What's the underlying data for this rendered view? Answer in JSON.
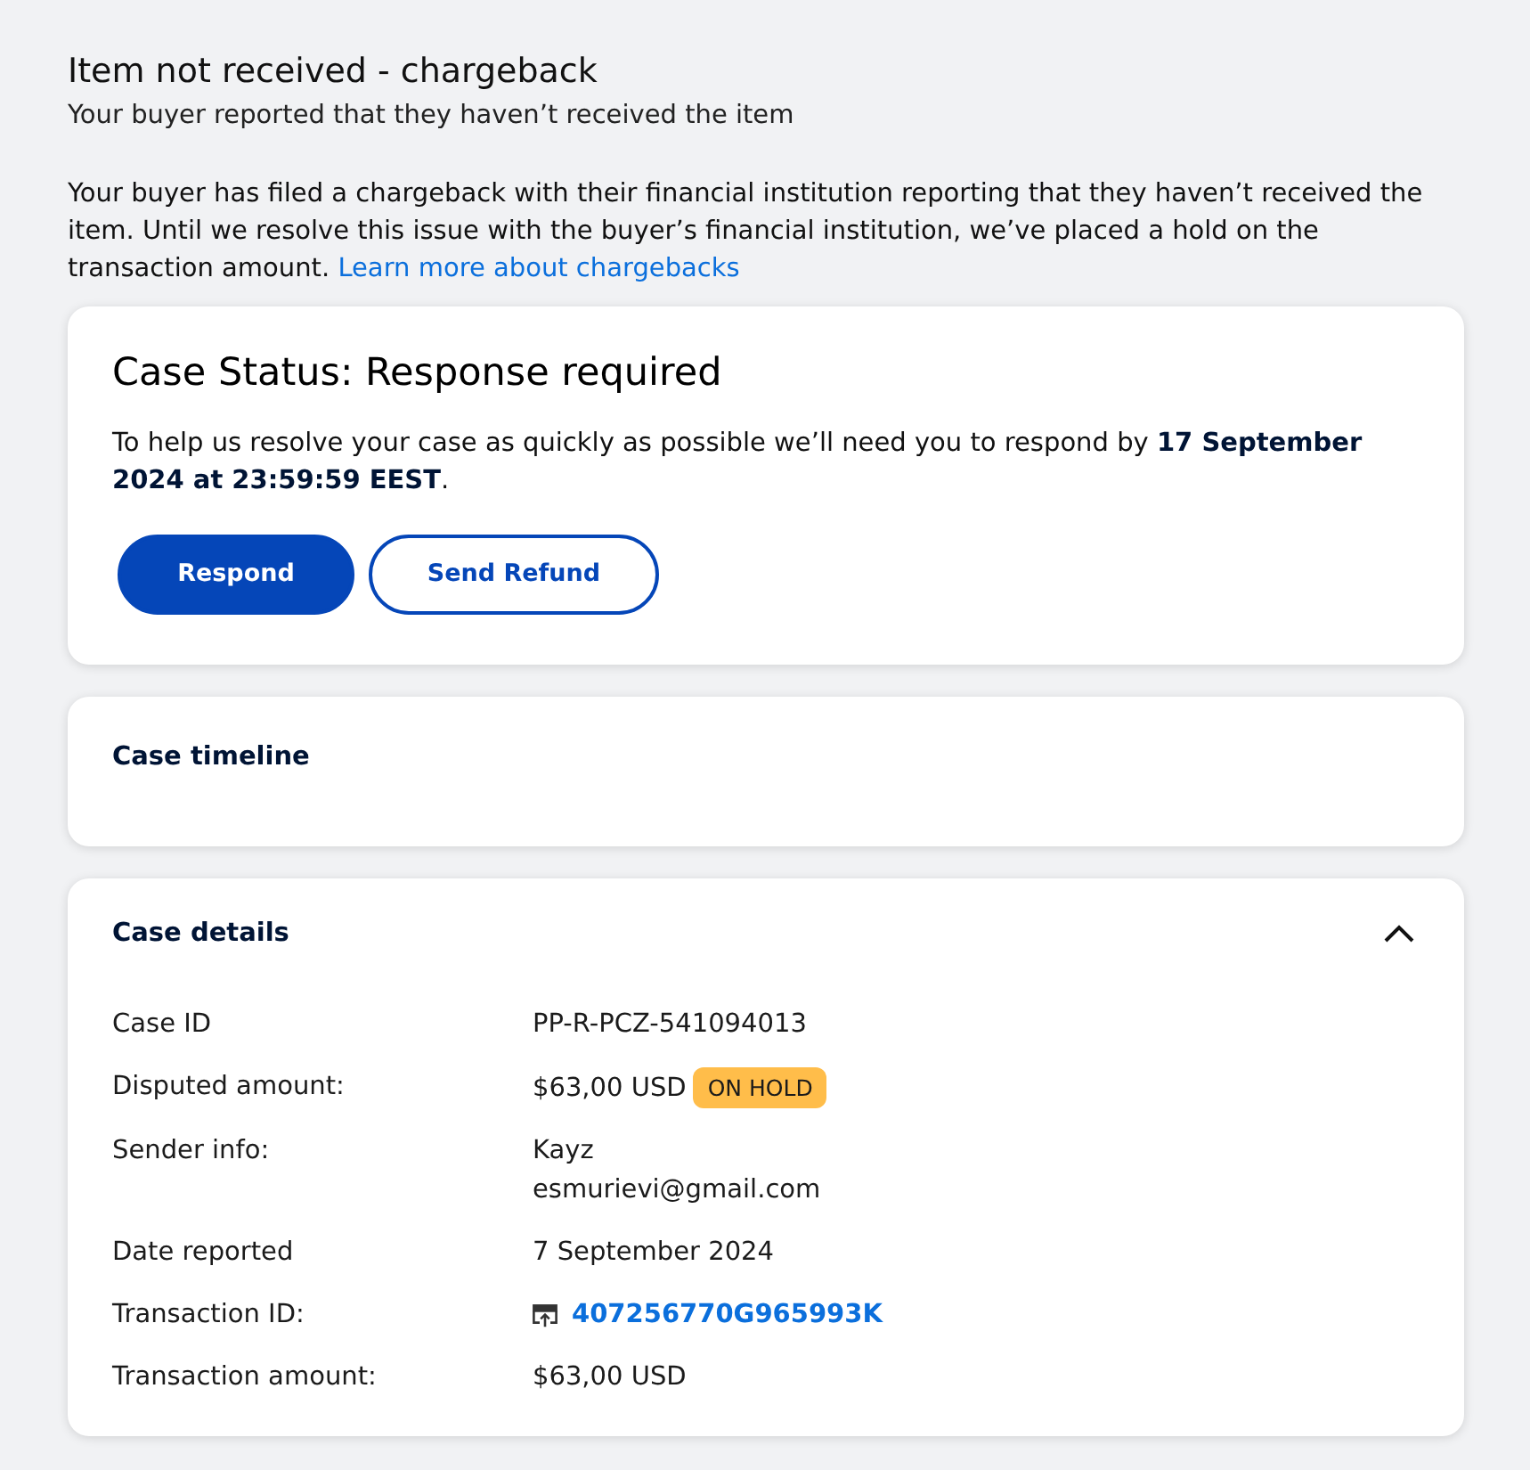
{
  "header": {
    "title": "Item not received - chargeback",
    "subtitle": "Your buyer reported that they haven’t received the item"
  },
  "intro": {
    "text": "Your buyer has filed a chargeback with their financial institution reporting that they haven’t received the item. Until we resolve this issue with the buyer’s financial institution, we’ve placed a hold on the transaction amount.",
    "link": "Learn more about chargebacks"
  },
  "status_card": {
    "title": "Case Status: Response required",
    "message": "To help us resolve your case as quickly as possible we’ll need you to respond by **17 September 2024 at 23:59:59 EEST**.",
    "buttons": [
      {
        "label": "Respond",
        "kind": "primary"
      },
      {
        "label": "Send Refund",
        "kind": "outline"
      }
    ]
  },
  "timeline_card": {
    "title": "Case timeline"
  },
  "details_card": {
    "title": "Case details",
    "expanded": true,
    "rows": [
      {
        "label": "Case ID",
        "kind": "text",
        "lines": [
          "PP-R-PCZ-541094013"
        ]
      },
      {
        "label": "Disputed amount:",
        "kind": "text",
        "lines": [
          "$63,00 USD"
        ],
        "badge": "ON HOLD"
      },
      {
        "label": "Sender info:",
        "kind": "text",
        "lines": [
          "Kayz",
          "esmurievi@gmail.com"
        ]
      },
      {
        "label": "Date reported",
        "kind": "text",
        "lines": [
          "7 September 2024"
        ]
      },
      {
        "label": "Transaction ID:",
        "kind": "link",
        "lines": [
          "407256770G965993K"
        ]
      },
      {
        "label": "Transaction amount:",
        "kind": "text",
        "lines": [
          "$63,00 USD"
        ]
      }
    ]
  }
}
